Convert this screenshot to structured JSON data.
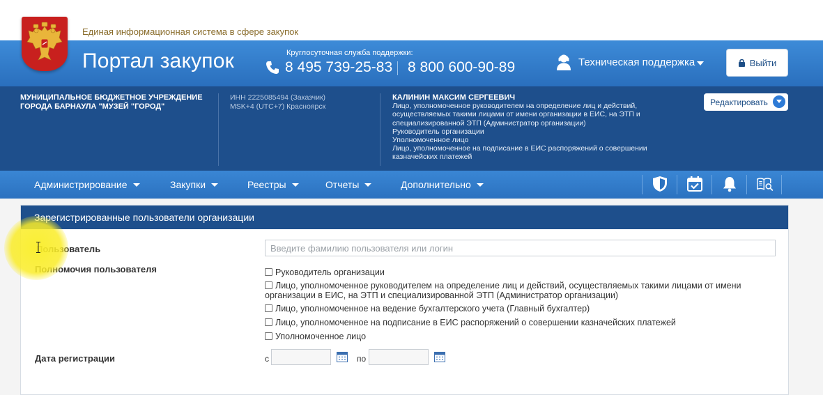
{
  "site": {
    "subtitle": "Единая информационная система в сфере закупок",
    "title": "Портал закупок"
  },
  "support": {
    "caption": "Круглосуточная служба поддержки:",
    "phone1": "8 495 739-25-83",
    "phone2": "8 800 600-90-89",
    "tech_support_label": "Техническая поддержка",
    "logout_label": "Выйти"
  },
  "org": {
    "name": "МУНИЦИПАЛЬНОЕ БЮДЖЕТНОЕ УЧРЕЖДЕНИЕ ГОРОДА БАРНАУЛА \"МУЗЕЙ \"ГОРОД\"",
    "inn": "ИНН 2225085494 (Заказчик)",
    "timezone": "MSK+4 (UTC+7) Красноярск",
    "user_name": "КАЛИНИН МАКСИМ СЕРГЕЕВИЧ",
    "user_roles": [
      "Лицо, уполномоченное руководителем на определение лиц и действий,",
      "осуществляемых такими лицами от имени организации в ЕИС, на ЭТП и",
      "специализированной ЭТП (Администратор организации)",
      "Руководитель организации",
      "Уполномоченное лицо",
      "Лицо, уполномоченное на подписание в ЕИС распоряжений о совершении",
      "казначейских платежей"
    ],
    "edit_label": "Редактировать"
  },
  "nav": {
    "items": [
      "Администрирование",
      "Закупки",
      "Реестры",
      "Отчеты",
      "Дополнительно"
    ],
    "icons": [
      "shield-icon",
      "calendar-check-icon",
      "bell-icon",
      "book-search-icon"
    ]
  },
  "panel": {
    "title": "Зарегистрированные пользователи организации",
    "user_label": "Пользователь",
    "user_placeholder": "Введите фамилию пользователя или логин",
    "user_value": "",
    "permissions_label": "Полномочия пользователя",
    "permissions": [
      {
        "label": "Руководитель организации",
        "checked": false
      },
      {
        "label": "Лицо, уполномоченное руководителем на определение лиц и действий, осуществляемых такими лицами от имени организации в ЕИС, на ЭТП и специализированной ЭТП (Администратор организации)",
        "checked": false
      },
      {
        "label": "Лицо, уполномоченное на ведение бухгалтерского учета (Главный бухгалтер)",
        "checked": false
      },
      {
        "label": "Лицо, уполномоченное на подписание в ЕИС распоряжений о совершении казначейских платежей",
        "checked": false
      },
      {
        "label": "Уполномоченное лицо",
        "checked": false
      }
    ],
    "date_label": "Дата регистрации",
    "date_from_prefix": "с",
    "date_to_prefix": "по",
    "date_from": "",
    "date_to": ""
  },
  "colors": {
    "header_blue": "#2f7acb",
    "dark_blue": "#1e4f8c",
    "emblem_red": "#c8201e",
    "subtitle_gold": "#8a6d2c"
  }
}
